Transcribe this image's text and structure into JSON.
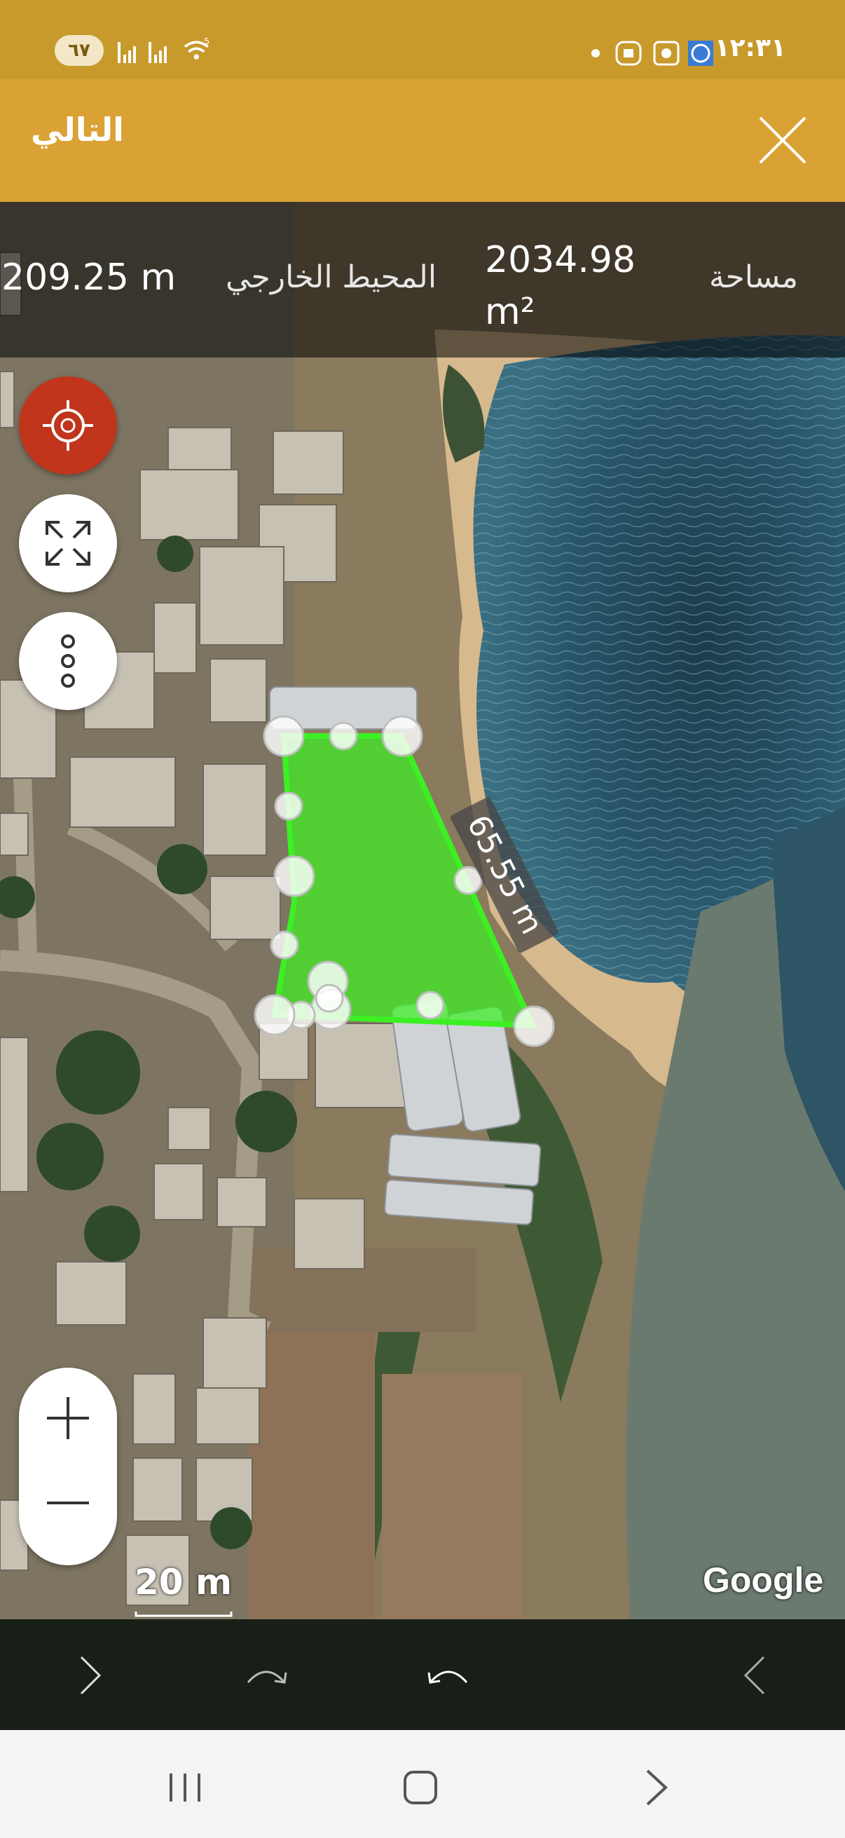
{
  "status_bar": {
    "battery": "٦٧",
    "network": "5",
    "time": "١٢:٣١"
  },
  "header": {
    "next_label": "التالي",
    "close_icon": "close-icon"
  },
  "measurements": {
    "perimeter_value": "209.25 m",
    "perimeter_label": "المحيط الخارجي",
    "area_value_line1": "2034.98",
    "area_value_line2": "m²",
    "area_label": "مساحة"
  },
  "map": {
    "segment_label": "65.55 m",
    "scale_label": "20 m",
    "attribution": "Google",
    "polygon_color": "#3cf023"
  },
  "controls": {
    "locate_icon": "crosshair-icon",
    "fullscreen_icon": "expand-icon",
    "more_icon": "more-vertical-icon",
    "zoom_in_icon": "plus-icon",
    "zoom_out_icon": "minus-icon"
  },
  "edit_bar": {
    "icons": [
      "chevron-right-icon",
      "redo-icon",
      "undo-icon",
      "chevron-left-icon"
    ]
  },
  "nav_bar": {
    "icons": [
      "recents-icon",
      "home-icon",
      "back-icon"
    ]
  },
  "colors": {
    "status_bar": "#c89a2c",
    "header": "#daa235",
    "locate_button": "#c0351c"
  }
}
